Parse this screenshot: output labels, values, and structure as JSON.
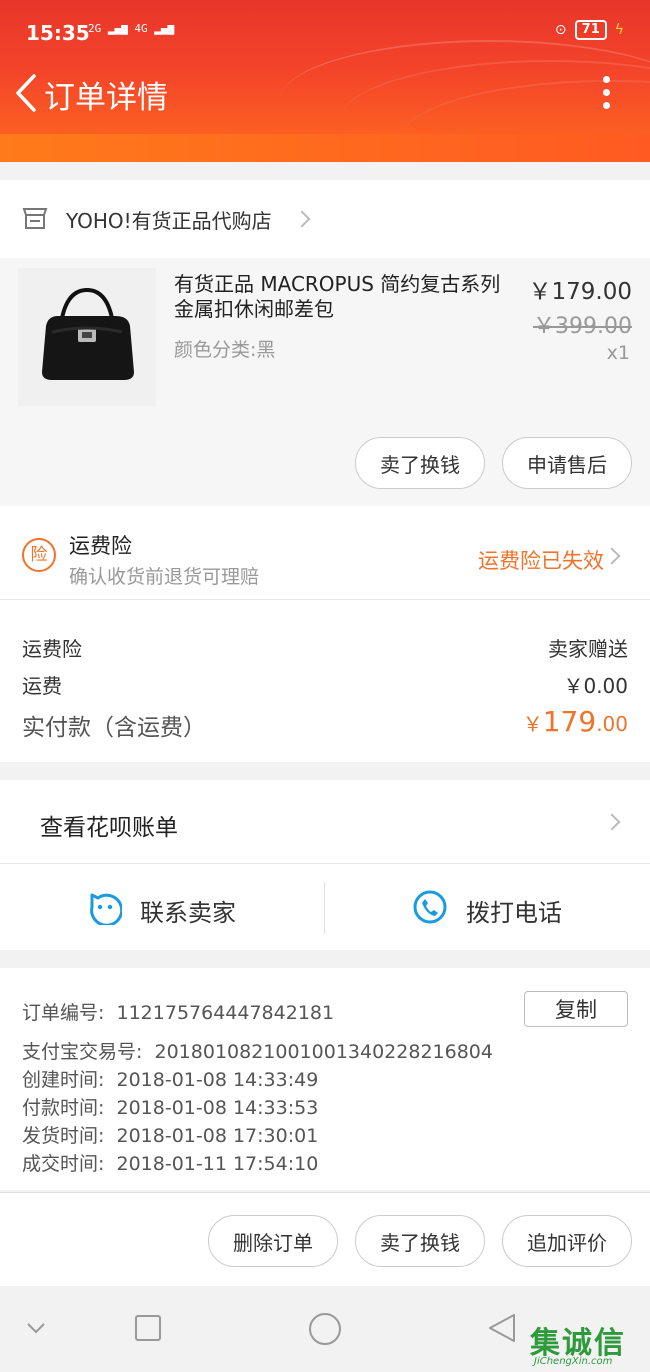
{
  "status_bar": {
    "time": "15:35",
    "signal_1": "2G",
    "signal_2": "4G",
    "battery": "71"
  },
  "header": {
    "title": "订单详情"
  },
  "shop": {
    "name": "YOHO!有货正品代购店"
  },
  "product": {
    "title": "有货正品 MACROPUS 简约复古系列金属扣休闲邮差包",
    "spec": "颜色分类:黑",
    "price": "￥179.00",
    "original_price": "￥399.00",
    "quantity": "x1",
    "actions": [
      "卖了换钱",
      "申请售后"
    ]
  },
  "insurance": {
    "badge": "险",
    "title": "运费险",
    "subtitle": "确认收货前退货可理赔",
    "status": "运费险已失效"
  },
  "fees": [
    {
      "label": "运费险",
      "value": "卖家赠送"
    },
    {
      "label": "运费",
      "value": "￥0.00"
    }
  ],
  "total": {
    "label": "实付款（含运费）",
    "currency": "￥",
    "integer": "179",
    "decimal": ".00"
  },
  "huabei": {
    "label": "查看花呗账单"
  },
  "contact": {
    "seller_label": "联系卖家",
    "phone_label": "拨打电话"
  },
  "order_info": {
    "copy_label": "复制",
    "lines": [
      {
        "label": "订单编号:",
        "value": "112175764447842181"
      },
      {
        "label": "支付宝交易号:",
        "value": "2018010821001001340228216804"
      },
      {
        "label": "创建时间:",
        "value": "2018-01-08 14:33:49"
      },
      {
        "label": "付款时间:",
        "value": "2018-01-08 14:33:53"
      },
      {
        "label": "发货时间:",
        "value": "2018-01-08 17:30:01"
      },
      {
        "label": "成交时间:",
        "value": "2018-01-11 17:54:10"
      }
    ]
  },
  "bottom_actions": [
    "删除订单",
    "卖了换钱",
    "追加评价"
  ],
  "watermark": {
    "text": "集诚信",
    "sub": "JiChengXin.com"
  },
  "colors": {
    "accent": "#f0732a",
    "header_red": "#e8352a",
    "contact_blue": "#1a9be0"
  }
}
